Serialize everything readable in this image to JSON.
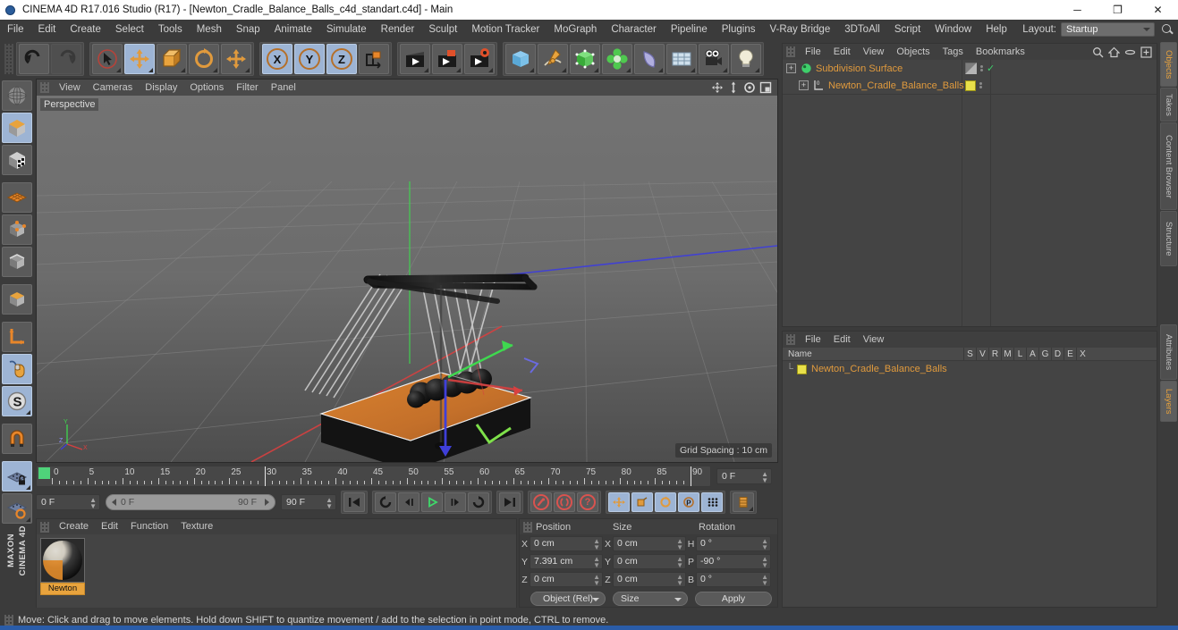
{
  "window": {
    "title": "CINEMA 4D R17.016 Studio (R17) - [Newton_Cradle_Balance_Balls_c4d_standart.c4d] - Main",
    "app_icon": "c4d-logo-icon",
    "minimize": "─",
    "maximize": "❐",
    "close": "✕"
  },
  "menubar": {
    "items": [
      {
        "label": "File"
      },
      {
        "label": "Edit"
      },
      {
        "label": "Create"
      },
      {
        "label": "Select"
      },
      {
        "label": "Tools"
      },
      {
        "label": "Mesh"
      },
      {
        "label": "Snap"
      },
      {
        "label": "Animate"
      },
      {
        "label": "Simulate"
      },
      {
        "label": "Render"
      },
      {
        "label": "Sculpt"
      },
      {
        "label": "Motion Tracker"
      },
      {
        "label": "MoGraph"
      },
      {
        "label": "Character"
      },
      {
        "label": "Pipeline"
      },
      {
        "label": "Plugins"
      },
      {
        "label": "V-Ray Bridge"
      },
      {
        "label": "3DToAll"
      },
      {
        "label": "Script"
      },
      {
        "label": "Window"
      },
      {
        "label": "Help"
      }
    ],
    "layout_label": "Layout:",
    "layout_value": "Startup",
    "search_icon": "magnifier-icon"
  },
  "toolbar": {
    "groups": [
      {
        "buttons": [
          {
            "name": "undo-button",
            "icon": "undo-arrow-icon",
            "state": "normal"
          },
          {
            "name": "redo-button",
            "icon": "redo-arrow-icon",
            "state": "disabled"
          }
        ]
      },
      {
        "buttons": [
          {
            "name": "live-selection-tool",
            "icon": "cursor-circle-icon",
            "state": "normal"
          },
          {
            "name": "move-tool",
            "icon": "move-cross-icon",
            "state": "selected"
          },
          {
            "name": "scale-tool",
            "icon": "scale-square-icon",
            "state": "normal"
          },
          {
            "name": "rotate-tool",
            "icon": "rotate-circle-icon",
            "state": "normal"
          },
          {
            "name": "transform-tool",
            "icon": "move-cross-icon",
            "state": "normal"
          }
        ]
      },
      {
        "buttons": [
          {
            "name": "x-axis-lock",
            "icon": "x-axis-icon",
            "label": "X",
            "state": "selected"
          },
          {
            "name": "y-axis-lock",
            "icon": "y-axis-icon",
            "label": "Y",
            "state": "selected"
          },
          {
            "name": "z-axis-lock",
            "icon": "z-axis-icon",
            "label": "Z",
            "state": "selected"
          },
          {
            "name": "world-object-coordinates",
            "icon": "world-axis-cube-icon",
            "state": "normal"
          }
        ]
      },
      {
        "buttons": [
          {
            "name": "render-view-button",
            "icon": "clapper-icon",
            "state": "normal"
          },
          {
            "name": "render-region-button",
            "icon": "clapper-region-icon",
            "state": "normal"
          },
          {
            "name": "render-settings-button",
            "icon": "clapper-gear-icon",
            "state": "normal"
          }
        ]
      },
      {
        "buttons": [
          {
            "name": "add-cube-button",
            "icon": "blue-cube-icon",
            "state": "normal"
          },
          {
            "name": "add-spline-button",
            "icon": "pen-spline-icon",
            "state": "normal"
          },
          {
            "name": "add-nurbs-button",
            "icon": "green-cube-icon",
            "state": "normal"
          },
          {
            "name": "add-array-button",
            "icon": "green-cluster-icon",
            "state": "normal"
          },
          {
            "name": "add-deformer-button",
            "icon": "purple-bend-icon",
            "state": "normal"
          },
          {
            "name": "add-environment-button",
            "icon": "grid-floor-icon",
            "state": "normal"
          },
          {
            "name": "add-camera-button",
            "icon": "camera-icon",
            "state": "normal"
          },
          {
            "name": "add-light-button",
            "icon": "lightbulb-icon",
            "state": "normal"
          }
        ]
      }
    ]
  },
  "left_toolbar": {
    "buttons": [
      {
        "name": "make-editable-button",
        "icon": "sphere-wire-icon",
        "state": "normal"
      },
      {
        "name": "model-mode-button",
        "icon": "orange-cube-icon",
        "state": "selected"
      },
      {
        "name": "texture-mode-button",
        "icon": "checker-cube-icon",
        "state": "normal"
      },
      {
        "name": "uv-mesh-button",
        "icon": "orange-grid-plane-icon",
        "state": "normal"
      },
      {
        "name": "points-mode-button",
        "icon": "cube-points-icon",
        "state": "normal"
      },
      {
        "name": "edges-mode-button",
        "icon": "cube-edges-icon",
        "state": "normal"
      },
      {
        "name": "polygons-mode-button",
        "icon": "cube-polygon-icon",
        "state": "normal"
      },
      {
        "name": "axis-mode-button",
        "icon": "orange-axis-icon",
        "state": "normal"
      },
      {
        "name": "viewport-solo-button",
        "icon": "mouse-icon",
        "state": "selected"
      },
      {
        "name": "snap-s-button",
        "icon": "s-circle-icon",
        "state": "selected"
      },
      {
        "name": "magnet-tool-button",
        "icon": "magnet-icon",
        "state": "normal"
      },
      {
        "name": "workplane-lock-button",
        "icon": "grid-lock-icon",
        "state": "selected"
      },
      {
        "name": "workplane-rotate-button",
        "icon": "grid-rotate-icon",
        "state": "normal"
      }
    ],
    "brand_line1": "MAXON",
    "brand_line2": "CINEMA 4D"
  },
  "viewport": {
    "menu": [
      {
        "label": "View"
      },
      {
        "label": "Cameras"
      },
      {
        "label": "Display"
      },
      {
        "label": "Options"
      },
      {
        "label": "Filter"
      },
      {
        "label": "Panel"
      }
    ],
    "icons": [
      {
        "name": "pan-view-icon"
      },
      {
        "name": "dolly-view-icon"
      },
      {
        "name": "rotate-view-icon"
      },
      {
        "name": "maximize-view-icon"
      }
    ],
    "label": "Perspective",
    "grid_spacing": "Grid Spacing : 10 cm",
    "axis_labels": {
      "x": "X",
      "y": "Y",
      "z": "Z"
    },
    "colors": {
      "ground_far": "#6f6f6f",
      "ground_near": "#4f4f4f",
      "base_wood": "#c8762a",
      "frame": "#1a1a1a",
      "axis_x": "#e04040",
      "axis_y": "#4fd34f",
      "axis_z": "#4040e0"
    }
  },
  "timeline": {
    "ticks": [
      "0",
      "5",
      "10",
      "15",
      "20",
      "25",
      "30",
      "35",
      "40",
      "45",
      "50",
      "55",
      "60",
      "65",
      "70",
      "75",
      "80",
      "85",
      "90"
    ],
    "min": 0,
    "max": 90,
    "current_frame_field": "0 F",
    "playhead_frame": 0
  },
  "playback": {
    "current_frame": "0 F",
    "range_start": "0 F",
    "range_end": "90 F",
    "end_frame": "90 F",
    "buttons": [
      {
        "name": "go-to-start-button",
        "icon": "skip-start-icon"
      },
      {
        "name": "play-reverse-loop-button",
        "icon": "loop-reverse-icon"
      },
      {
        "name": "step-back-button",
        "icon": "step-back-icon"
      },
      {
        "name": "play-button",
        "icon": "play-icon"
      },
      {
        "name": "step-forward-button",
        "icon": "step-forward-icon"
      },
      {
        "name": "loop-button",
        "icon": "loop-icon"
      },
      {
        "name": "go-to-end-button",
        "icon": "skip-end-icon"
      },
      {
        "name": "record-keyframe-button",
        "icon": "record-key-icon"
      },
      {
        "name": "autokeying-button",
        "icon": "autokey-icon"
      },
      {
        "name": "keyframe-selection-button",
        "icon": "question-key-icon"
      },
      {
        "name": "record-position-button",
        "icon": "move-key-icon"
      },
      {
        "name": "record-scale-button",
        "icon": "scale-key-icon"
      },
      {
        "name": "record-rotation-button",
        "icon": "rotate-key-icon"
      },
      {
        "name": "record-pla-button",
        "icon": "p-key-icon"
      },
      {
        "name": "record-parameter-button",
        "icon": "dots-key-icon"
      },
      {
        "name": "keyframe-mode-button",
        "icon": "layers-key-icon"
      }
    ]
  },
  "material_manager": {
    "menu": [
      {
        "label": "Create"
      },
      {
        "label": "Edit"
      },
      {
        "label": "Function"
      },
      {
        "label": "Texture"
      }
    ],
    "materials": [
      {
        "name": "Newton",
        "color": "#e8a33d"
      }
    ]
  },
  "coordinates": {
    "headers": {
      "position": "Position",
      "size": "Size",
      "rotation": "Rotation"
    },
    "position": {
      "x_label": "X",
      "x_value": "0 cm",
      "y_label": "Y",
      "y_value": "7.391 cm",
      "z_label": "Z",
      "z_value": "0 cm"
    },
    "size": {
      "x_label": "X",
      "x_value": "0 cm",
      "y_label": "Y",
      "y_value": "0 cm",
      "z_label": "Z",
      "z_value": "0 cm"
    },
    "rotation": {
      "h_label": "H",
      "h_value": "0 °",
      "p_label": "P",
      "p_value": "-90 °",
      "b_label": "B",
      "b_value": "0 °"
    },
    "mode_dropdown": "Object (Rel)",
    "size_dropdown": "Size",
    "apply_button": "Apply"
  },
  "object_manager": {
    "menu": [
      {
        "label": "File"
      },
      {
        "label": "Edit"
      },
      {
        "label": "View"
      },
      {
        "label": "Objects"
      },
      {
        "label": "Tags"
      },
      {
        "label": "Bookmarks"
      }
    ],
    "icons": [
      {
        "name": "search-icon"
      },
      {
        "name": "home-icon"
      },
      {
        "name": "collapse-icon"
      },
      {
        "name": "expand-all-icon"
      }
    ],
    "rows": [
      {
        "name": "Subdivision Surface",
        "indent": 0,
        "icon": "subdivision-surface-icon",
        "icon_color": "#3ecf6b",
        "has_expander": true,
        "tag_type": "display-tag",
        "enabled": true
      },
      {
        "name": "Newton_Cradle_Balance_Balls",
        "indent": 1,
        "icon": "null-object-icon",
        "icon_color": "#bcbcbc",
        "has_expander": true,
        "tag_type": "material-tag",
        "tag_color": "#e8e04a",
        "enabled": true
      }
    ]
  },
  "layer_manager": {
    "menu": [
      {
        "label": "File"
      },
      {
        "label": "Edit"
      },
      {
        "label": "View"
      }
    ],
    "columns": [
      "Name",
      "S",
      "V",
      "R",
      "M",
      "L",
      "A",
      "G",
      "D",
      "E",
      "X"
    ],
    "rows": [
      {
        "name": "Newton_Cradle_Balance_Balls",
        "color": "#e8e04a"
      }
    ]
  },
  "right_tabs": {
    "upper": [
      {
        "label": "Objects",
        "selected": true
      },
      {
        "label": "Takes",
        "selected": false
      },
      {
        "label": "Content Browser",
        "selected": false
      },
      {
        "label": "Structure",
        "selected": false
      }
    ],
    "lower": [
      {
        "label": "Attributes",
        "selected": false
      },
      {
        "label": "Layers",
        "selected": true
      }
    ]
  },
  "statusbar": {
    "text": "Move: Click and drag to move elements. Hold down SHIFT to quantize movement / add to the selection in point mode, CTRL to remove."
  }
}
